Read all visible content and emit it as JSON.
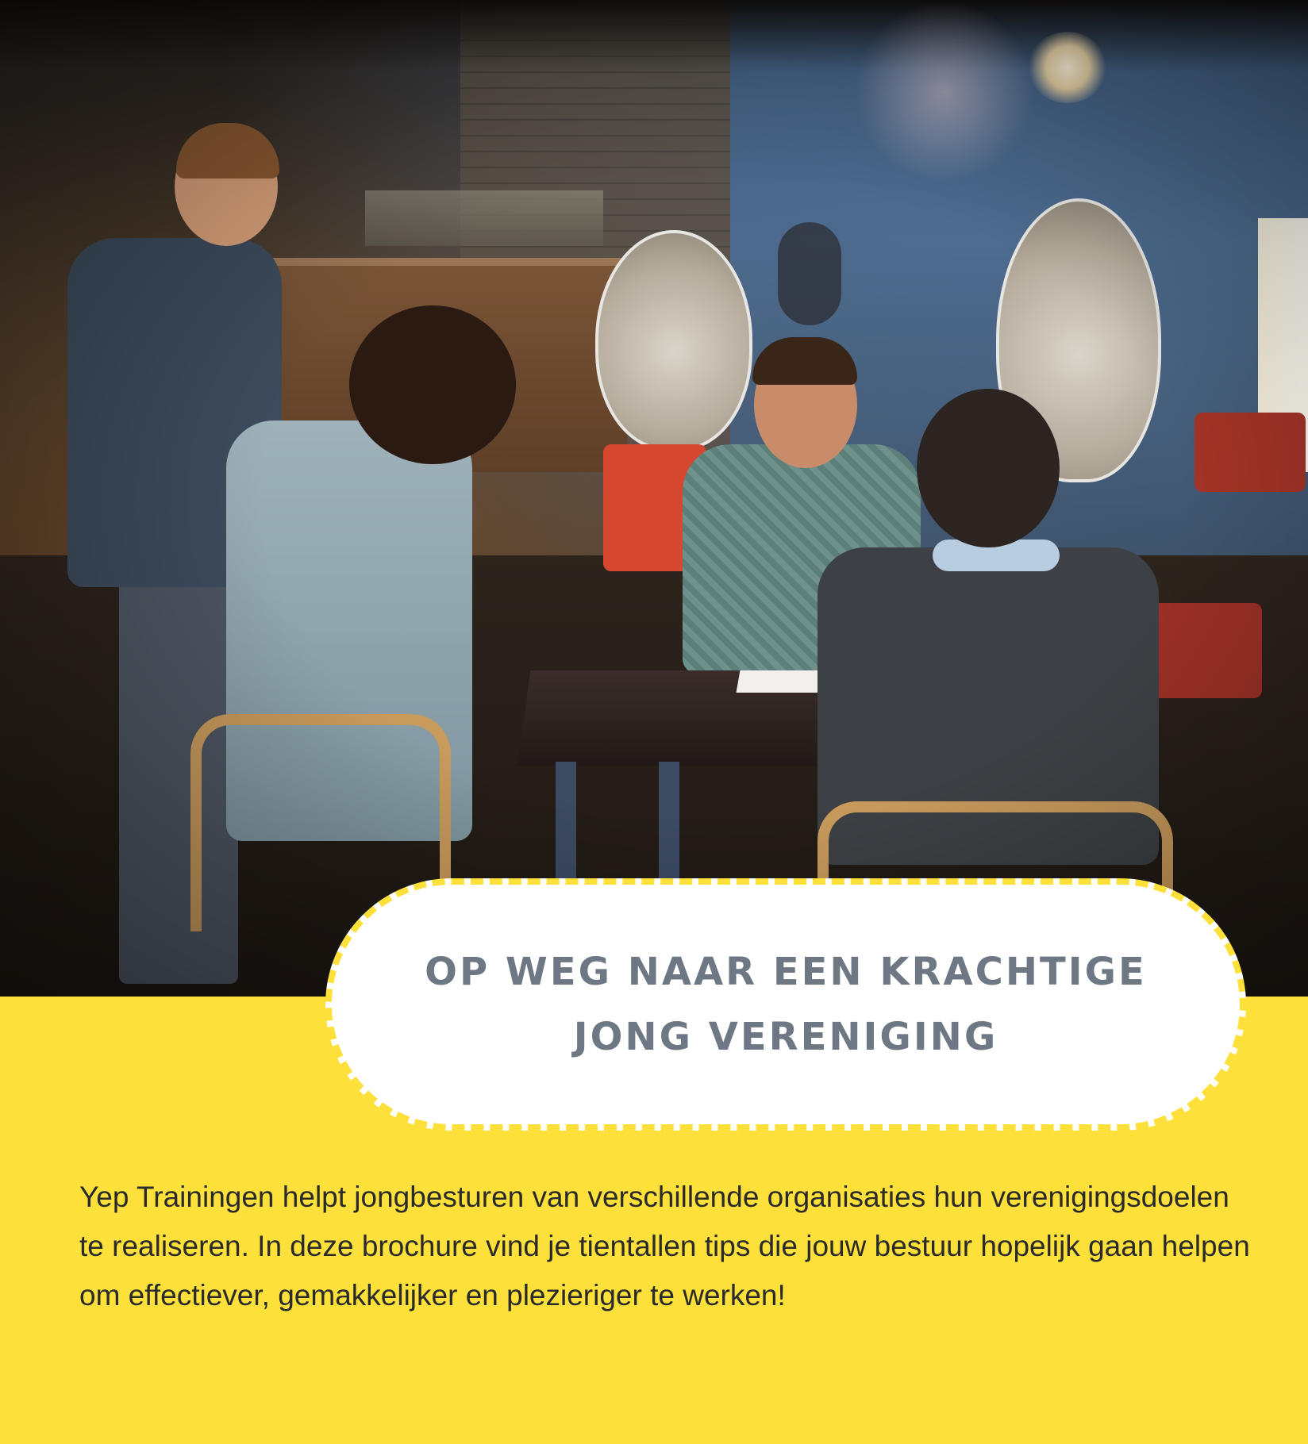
{
  "title": "OP WEG NAAR EEN KRACHTIGE JONG VERENIGING",
  "intro": "Yep Trainingen helpt jongbesturen van verschillende organisaties hun verenigingsdoelen te realiseren. In deze brochure vind je tientallen tips die jouw bestuur hopelijk gaan helpen om effectiever, gemakkelijker en plezieriger te werken!",
  "colors": {
    "background": "#fde03a",
    "title_text": "#6e7784",
    "body_text": "#2a2a2a",
    "pill": "#ffffff"
  }
}
